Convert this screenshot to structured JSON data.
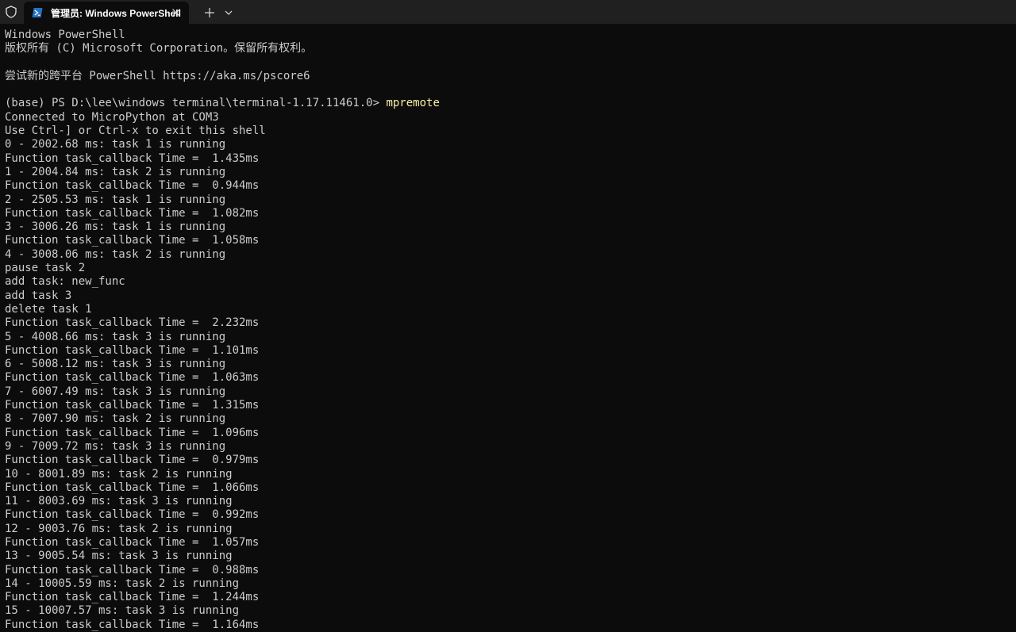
{
  "tab": {
    "title": "管理员: Windows PowerShell",
    "icon": "powershell-icon"
  },
  "tabbar_icons": {
    "shield": "shield-icon",
    "close": "close-icon",
    "new_tab": "plus-icon",
    "dropdown": "chevron-down-icon"
  },
  "colors": {
    "background": "#0c0c0c",
    "tabbar": "#202020",
    "text": "#cccccc",
    "command": "#f9f1a5",
    "powershell_blue": "#2671be"
  },
  "terminal": {
    "header": [
      "Windows PowerShell",
      "版权所有 (C) Microsoft Corporation。保留所有权利。",
      "",
      "尝试新的跨平台 PowerShell https://aka.ms/pscore6",
      ""
    ],
    "prompt": "(base) PS D:\\lee\\windows terminal\\terminal-1.17.11461.0> ",
    "command": "mpremote",
    "output": [
      "Connected to MicroPython at COM3",
      "Use Ctrl-] or Ctrl-x to exit this shell",
      "0 - 2002.68 ms: task 1 is running",
      "Function task_callback Time =  1.435ms",
      "1 - 2004.84 ms: task 2 is running",
      "Function task_callback Time =  0.944ms",
      "2 - 2505.53 ms: task 1 is running",
      "Function task_callback Time =  1.082ms",
      "3 - 3006.26 ms: task 1 is running",
      "Function task_callback Time =  1.058ms",
      "4 - 3008.06 ms: task 2 is running",
      "pause task 2",
      "add task: new_func",
      "add task 3",
      "delete task 1",
      "Function task_callback Time =  2.232ms",
      "5 - 4008.66 ms: task 3 is running",
      "Function task_callback Time =  1.101ms",
      "6 - 5008.12 ms: task 3 is running",
      "Function task_callback Time =  1.063ms",
      "7 - 6007.49 ms: task 3 is running",
      "Function task_callback Time =  1.315ms",
      "8 - 7007.90 ms: task 2 is running",
      "Function task_callback Time =  1.096ms",
      "9 - 7009.72 ms: task 3 is running",
      "Function task_callback Time =  0.979ms",
      "10 - 8001.89 ms: task 2 is running",
      "Function task_callback Time =  1.066ms",
      "11 - 8003.69 ms: task 3 is running",
      "Function task_callback Time =  0.992ms",
      "12 - 9003.76 ms: task 2 is running",
      "Function task_callback Time =  1.057ms",
      "13 - 9005.54 ms: task 3 is running",
      "Function task_callback Time =  0.988ms",
      "14 - 10005.59 ms: task 2 is running",
      "Function task_callback Time =  1.244ms",
      "15 - 10007.57 ms: task 3 is running",
      "Function task_callback Time =  1.164ms"
    ]
  }
}
